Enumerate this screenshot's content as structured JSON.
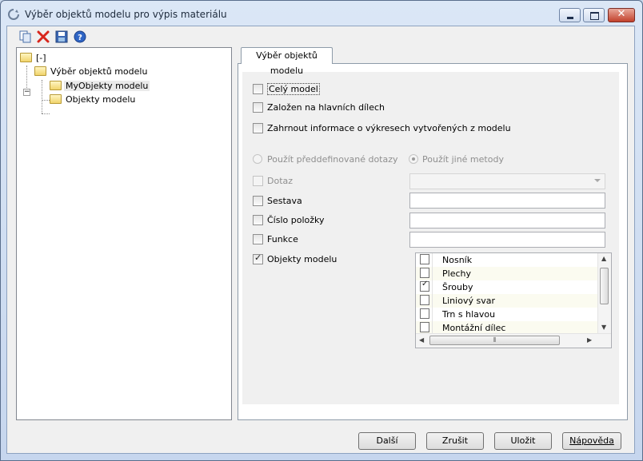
{
  "window": {
    "title": "Výběr objektů modelu pro výpis materiálu"
  },
  "tree": {
    "items": [
      {
        "label": "[-]"
      },
      {
        "label": "Výběr objektů modelu"
      },
      {
        "label": "MyObjekty modelu"
      },
      {
        "label": "Objekty modelu"
      }
    ]
  },
  "tab": {
    "label": "Výběr objektů modelu"
  },
  "options": {
    "cely_model": {
      "label": "Celý model",
      "checked": false
    },
    "zalozen": {
      "label": "Založen na hlavních dílech",
      "checked": false
    },
    "zahrnout": {
      "label": "Zahrnout informace o výkresech vytvořených z modelu",
      "checked": false
    },
    "radio_predef": {
      "label": "Použít předdefinované dotazy",
      "selected": false
    },
    "radio_jine": {
      "label": "Použít jiné metody",
      "selected": true
    },
    "dotaz": {
      "label": "Dotaz",
      "checked": false,
      "value": ""
    },
    "sestava": {
      "label": "Sestava",
      "checked": false,
      "value": ""
    },
    "cislo_polozky": {
      "label": "Číslo položky",
      "checked": false,
      "value": ""
    },
    "funkce": {
      "label": "Funkce",
      "checked": false,
      "value": ""
    },
    "objekty_modelu": {
      "label": "Objekty modelu",
      "checked": true
    }
  },
  "object_list": [
    {
      "label": "Nosník",
      "checked": false
    },
    {
      "label": "Plechy",
      "checked": false
    },
    {
      "label": "Šrouby",
      "checked": true
    },
    {
      "label": "Liniový svar",
      "checked": false
    },
    {
      "label": "Trn s hlavou",
      "checked": false
    },
    {
      "label": "Montážní dílec",
      "checked": false
    }
  ],
  "buttons": {
    "next": "Další",
    "cancel": "Zrušit",
    "save": "Uložit",
    "help": "Nápověda"
  },
  "check_glyph": "✓",
  "icons": [
    "copy-icon",
    "delete-icon",
    "save-icon",
    "help-icon",
    "folder-icon",
    "app-icon"
  ]
}
